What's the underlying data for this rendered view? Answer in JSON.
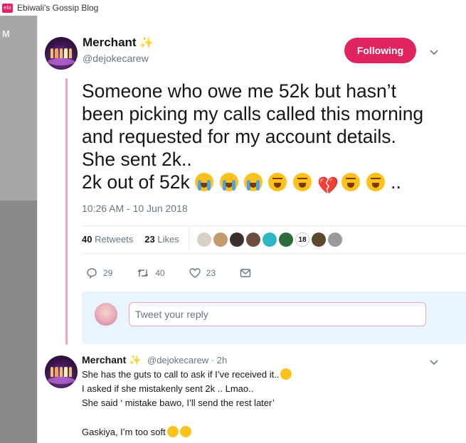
{
  "window": {
    "favicon_text": "ebi",
    "title": "Ebiwali's Gossip Blog"
  },
  "sidebar": {
    "letter": "M"
  },
  "tweet": {
    "author_name": "Merchant",
    "name_emoji": "✨",
    "handle": "@dejokecarew",
    "follow_label": "Following",
    "text_lines": [
      "Someone who owe me 52k but hasn’t",
      "been picking my calls called this morning",
      "and requested for my account details.",
      "She sent 2k..",
      "2k out of 52k"
    ],
    "text_trailing": "..",
    "timestamp": "10:26 AM - 10 Jun 2018",
    "retweets_count": "40",
    "retweets_label": "Retweets",
    "likes_count": "23",
    "likes_label": "Likes",
    "liker_badge": "18",
    "actions": {
      "reply_count": "29",
      "retweet_count": "40",
      "like_count": "23"
    }
  },
  "reply_box": {
    "placeholder": "Tweet your reply"
  },
  "reply": {
    "author_name": "Merchant",
    "name_emoji": "✨",
    "handle_time": "@dejokecarew · 2h",
    "lines": [
      "She has the guts to call to ask if I’ve received it..",
      "I asked if she mistakenly sent 2k .. Lmao..",
      "She said ‘ mistake bawo, I’ll send the rest later’",
      "",
      "Gaskiya, I’m too soft"
    ]
  },
  "colors": {
    "accent": "#e0245e",
    "thread": "#f2a1bf",
    "reply_bg": "#e8f5fd",
    "muted": "#657786"
  }
}
